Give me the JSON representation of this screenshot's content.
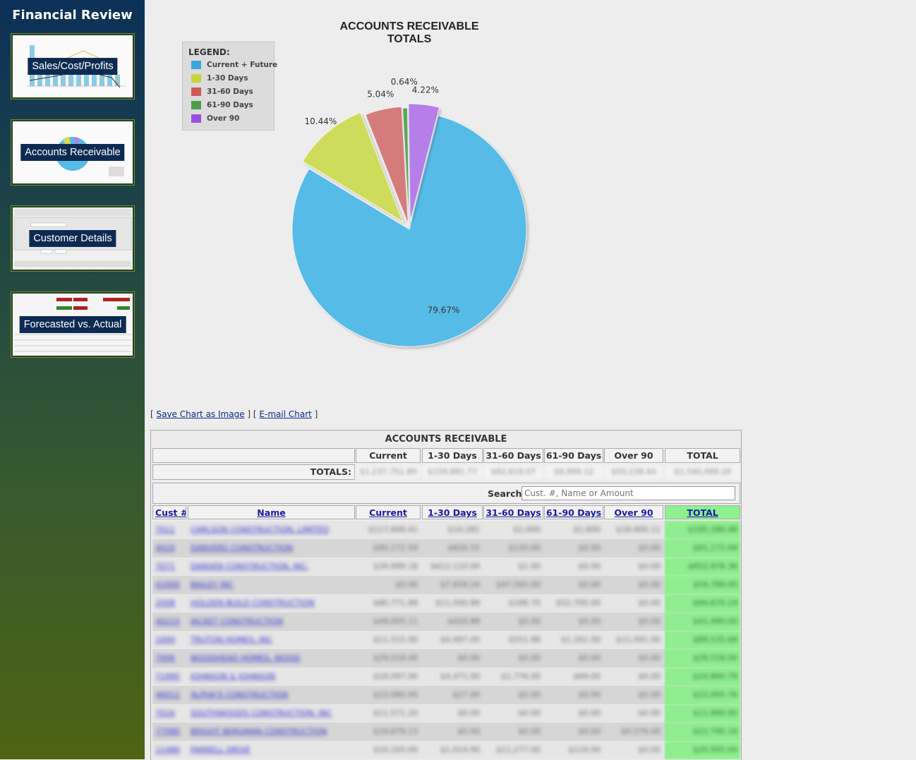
{
  "sidebar": {
    "title": "Financial Review",
    "items": [
      {
        "label": "Sales/Cost/Profits"
      },
      {
        "label": "Accounts Receivable"
      },
      {
        "label": "Customer Details"
      },
      {
        "label": "Forecasted vs. Actual"
      }
    ]
  },
  "chart": {
    "title_line1": "ACCOUNTS RECEIVABLE",
    "title_line2": "TOTALS",
    "legend_title": "LEGEND:",
    "save_link": "Save Chart as Image",
    "email_link": "E-mail Chart",
    "brackets": [
      "[",
      "] [",
      "]"
    ]
  },
  "chart_data": {
    "type": "pie",
    "title": "ACCOUNTS RECEIVABLE TOTALS",
    "legend_placement": "top-left",
    "slices": [
      {
        "label": "Current + Future",
        "value": 79.67,
        "color": "#56bbe6",
        "display": "79.67%"
      },
      {
        "label": "1-30 Days",
        "value": 10.44,
        "color": "#cfdb5a",
        "display": "10.44%"
      },
      {
        "label": "31-60 Days",
        "value": 5.04,
        "color": "#d47c7c",
        "display": "5.04%"
      },
      {
        "label": "61-90 Days",
        "value": 0.64,
        "color": "#5aa55a",
        "display": "0.64%"
      },
      {
        "label": "Over 90",
        "value": 4.22,
        "color": "#b57ee8",
        "display": "4.22%"
      }
    ]
  },
  "table": {
    "title": "ACCOUNTS RECEIVABLE",
    "columns": [
      "Current",
      "1-30 Days",
      "31-60 Days",
      "61-90 Days",
      "Over 90",
      "TOTAL"
    ],
    "totals_label": "TOTALS:",
    "totals_values": [
      "$1,237,751.89",
      "$159,881.77",
      "$82,618.07",
      "$9,999.12",
      "$50,238.44",
      "$1,540,489.29"
    ],
    "search_label": "Search:",
    "search_placeholder": "Cust. #, Name or Amount",
    "list_headers": [
      "Cust #",
      "Name",
      "Current",
      "1-30 Days",
      "31-60 Days",
      "61-90 Days",
      "Over 90",
      "TOTAL"
    ],
    "rows": [
      [
        "7011",
        "CARLSON CONSTRUCTION, LIMITED",
        "$117,999.41",
        "$14,281",
        "$1,000",
        "$1,600",
        "$18,900.11",
        "$195,396.98"
      ],
      [
        "4020",
        "DANVERS CONSTRUCTION",
        "$90,172.59",
        "$826.55",
        "$120.00",
        "$0.00",
        "$0.00",
        "$91,172.09"
      ],
      [
        "7071",
        "DANSEN CONSTRUCTION, INC.",
        "$39,999.18",
        "$612,110.00",
        "$1.00",
        "$0.00",
        "$0.00",
        "$652,976.36"
      ],
      [
        "41000",
        "BAILEY INC",
        "$0.00",
        "$7,659.24",
        "$47,565.00",
        "$0.00",
        "$0.00",
        "$59,789.00"
      ],
      [
        "2008",
        "HOLDEN BUILD CONSTRUCTION",
        "$80,771.88",
        "$11,500.88",
        "$188.70",
        "$52,700.00",
        "$0.00",
        "$94,670.19"
      ],
      [
        "40215",
        "JACKET CONSTRUCTION",
        "$49,005.11",
        "$420.88",
        "$0.00",
        "$0.00",
        "$0.00",
        "$41,490.00"
      ],
      [
        "1000",
        "TRUTON HOMES, INC",
        "$11,515.00",
        "$4,497.00",
        "$551.88",
        "$1,161.00",
        "$11,091.00",
        "$89,535.68"
      ],
      [
        "7006",
        "WOODHEAD HOMES, WOOD",
        "$29,518.00",
        "$0.00",
        "$0.00",
        "$0.00",
        "$0.00",
        "$29,518.00"
      ],
      [
        "71995",
        "JOHNSON & JOHNSON",
        "$18,097.00",
        "$4,471.00",
        "$1,776.00",
        "$69.00",
        "$0.00",
        "$24,800.78"
      ],
      [
        "46012",
        "ALPHA'S CONSTRUCTION",
        "$22,080.00",
        "$27.00",
        "$0.00",
        "$0.00",
        "$0.00",
        "$22,005.76"
      ],
      [
        "7016",
        "SOUTHWOODS CONSTRUCTION, INC",
        "$11,571.20",
        "$0.00",
        "$0.00",
        "$0.00",
        "$0.00",
        "$11,990.00"
      ],
      [
        "77080",
        "BRIGHT BERGMAN CONSTRUCTION",
        "$19,879.13",
        "$0.00",
        "$0.00",
        "$0.00",
        "$0,579.00",
        "$22,790.18"
      ],
      [
        "11480",
        "FARRELL DRIVE",
        "$10,165.00",
        "$1,014.00",
        "$11,277.00",
        "$119.00",
        "$0.00",
        "$20,505.00"
      ]
    ]
  }
}
